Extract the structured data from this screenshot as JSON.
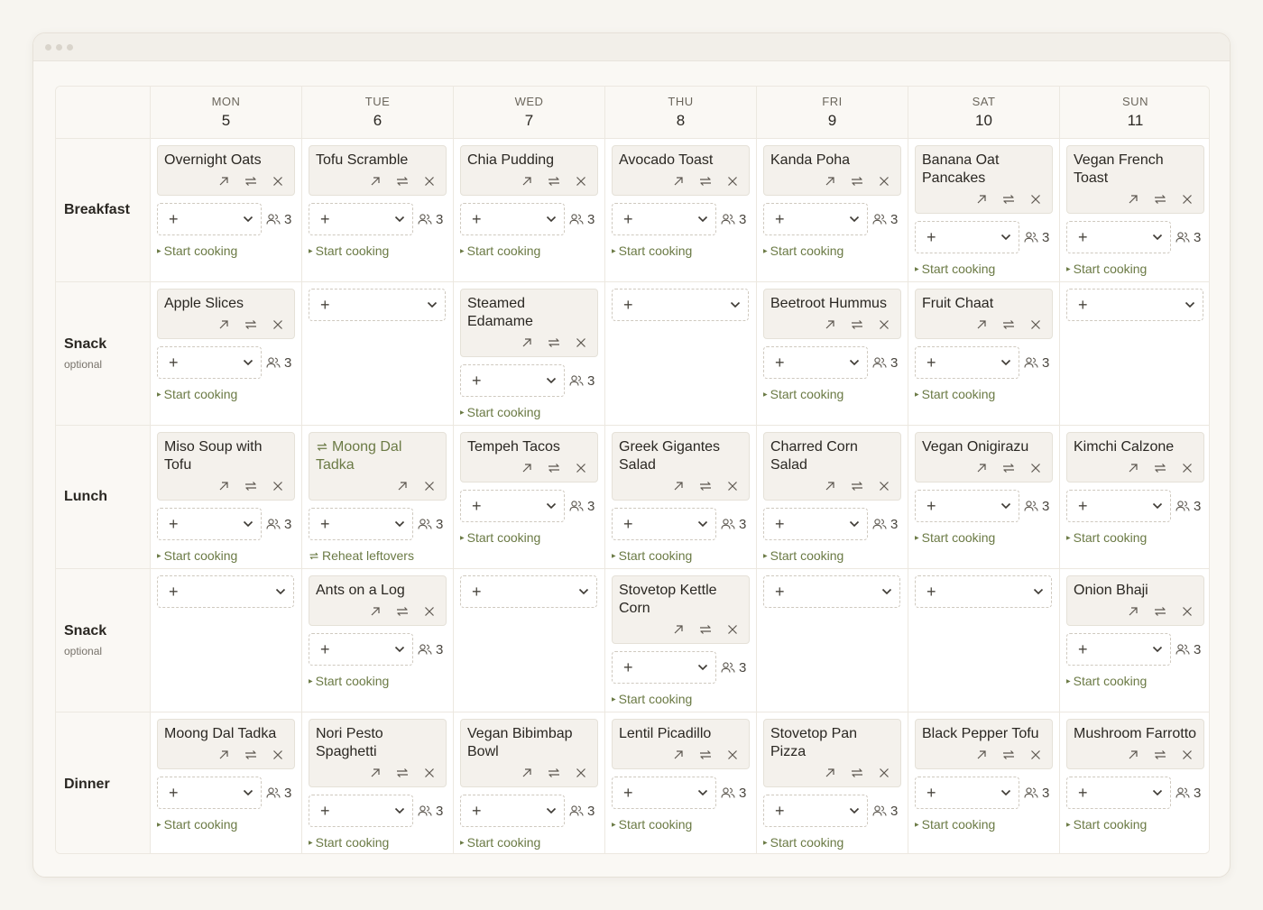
{
  "days": [
    {
      "name": "MON",
      "num": "5"
    },
    {
      "name": "TUE",
      "num": "6"
    },
    {
      "name": "WED",
      "num": "7"
    },
    {
      "name": "THU",
      "num": "8"
    },
    {
      "name": "FRI",
      "num": "9"
    },
    {
      "name": "SAT",
      "num": "10"
    },
    {
      "name": "SUN",
      "num": "11"
    }
  ],
  "rows": [
    {
      "label": "Breakfast",
      "optional": "",
      "cells": [
        {
          "title": "Overnight Oats",
          "servings": "3",
          "action": "Start cooking"
        },
        {
          "title": "Tofu Scramble",
          "servings": "3",
          "action": "Start cooking"
        },
        {
          "title": "Chia Pudding",
          "servings": "3",
          "action": "Start cooking"
        },
        {
          "title": "Avocado Toast",
          "servings": "3",
          "action": "Start cooking"
        },
        {
          "title": "Kanda Poha",
          "servings": "3",
          "action": "Start cooking"
        },
        {
          "title": "Banana Oat Pancakes",
          "servings": "3",
          "action": "Start cooking"
        },
        {
          "title": "Vegan French Toast",
          "servings": "3",
          "action": "Start cooking"
        }
      ]
    },
    {
      "label": "Snack",
      "optional": "optional",
      "cells": [
        {
          "title": "Apple Slices",
          "servings": "3",
          "action": "Start cooking"
        },
        null,
        {
          "title": "Steamed Edamame",
          "servings": "3",
          "action": "Start cooking"
        },
        null,
        {
          "title": "Beetroot Hummus",
          "servings": "3",
          "action": "Start cooking"
        },
        {
          "title": "Fruit Chaat",
          "servings": "3",
          "action": "Start cooking"
        },
        null
      ]
    },
    {
      "label": "Lunch",
      "optional": "",
      "cells": [
        {
          "title": "Miso Soup with Tofu",
          "servings": "3",
          "action": "Start cooking"
        },
        {
          "title": "Moong Dal Tadka",
          "servings": "3",
          "action": "Reheat leftovers",
          "leftover": true
        },
        {
          "title": "Tempeh Tacos",
          "servings": "3",
          "action": "Start cooking"
        },
        {
          "title": "Greek Gigantes Salad",
          "servings": "3",
          "action": "Start cooking"
        },
        {
          "title": "Charred Corn Salad",
          "servings": "3",
          "action": "Start cooking"
        },
        {
          "title": "Vegan Onigirazu",
          "servings": "3",
          "action": "Start cooking"
        },
        {
          "title": "Kimchi Calzone",
          "servings": "3",
          "action": "Start cooking"
        }
      ]
    },
    {
      "label": "Snack",
      "optional": "optional",
      "cells": [
        null,
        {
          "title": "Ants on a Log",
          "servings": "3",
          "action": "Start cooking"
        },
        null,
        {
          "title": "Stovetop Kettle Corn",
          "servings": "3",
          "action": "Start cooking"
        },
        null,
        null,
        {
          "title": "Onion Bhaji",
          "servings": "3",
          "action": "Start cooking"
        }
      ]
    },
    {
      "label": "Dinner",
      "optional": "",
      "cells": [
        {
          "title": "Moong Dal Tadka",
          "servings": "3",
          "action": "Start cooking"
        },
        {
          "title": "Nori Pesto Spaghetti",
          "servings": "3",
          "action": "Start cooking"
        },
        {
          "title": "Vegan Bibimbap Bowl",
          "servings": "3",
          "action": "Start cooking"
        },
        {
          "title": "Lentil Picadillo",
          "servings": "3",
          "action": "Start cooking"
        },
        {
          "title": "Stovetop Pan Pizza",
          "servings": "3",
          "action": "Start cooking"
        },
        {
          "title": "Black Pepper Tofu",
          "servings": "3",
          "action": "Start cooking"
        },
        {
          "title": "Mushroom Farrotto",
          "servings": "3",
          "action": "Start cooking"
        }
      ]
    }
  ],
  "add_symbol": "+",
  "colors": {
    "accent": "#6b7a45",
    "card_bg": "#f4f1ec",
    "page_bg": "#f7f5f0"
  }
}
